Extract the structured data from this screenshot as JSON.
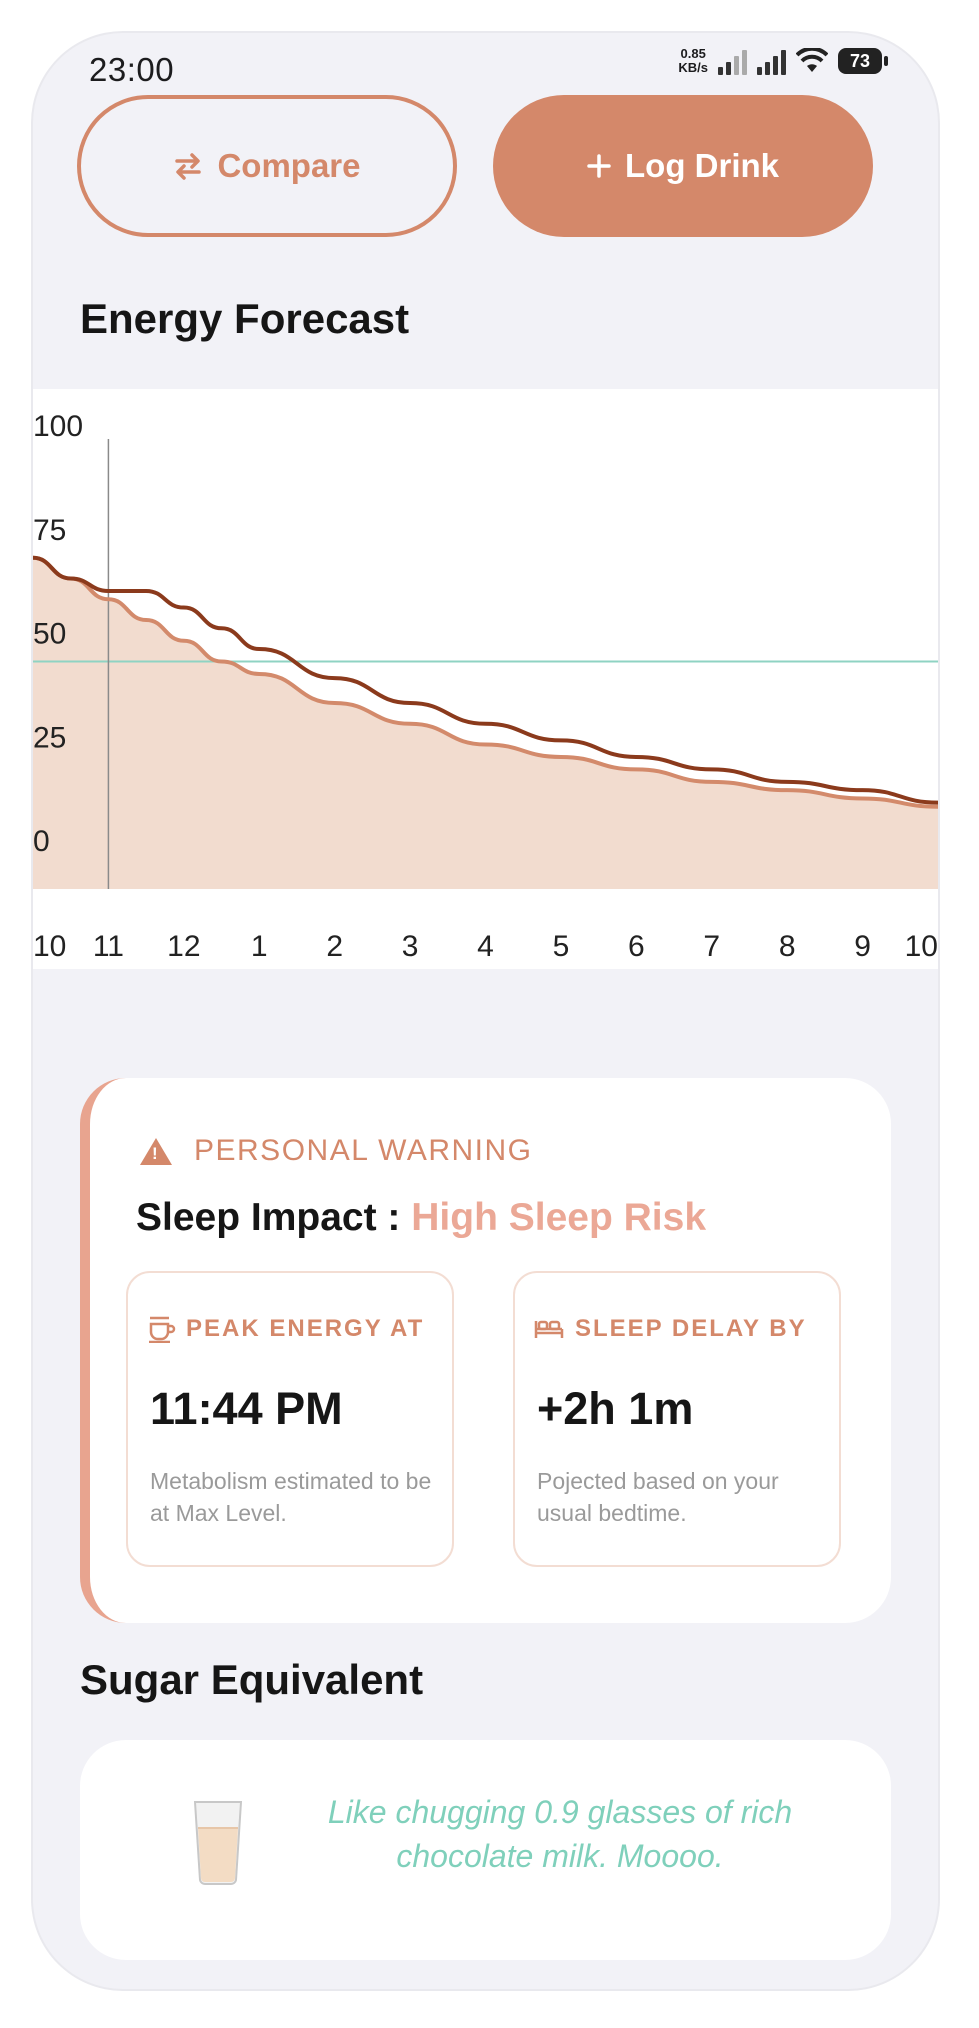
{
  "status_bar": {
    "time": "23:00",
    "net_speed_value": "0.85",
    "net_speed_unit": "KB/s",
    "battery": "73"
  },
  "buttons": {
    "compare": "Compare",
    "log_drink": "Log Drink"
  },
  "icons": {
    "compare": "swap-arrows-icon",
    "log_drink": "plus-icon"
  },
  "energy_section": {
    "title": "Energy Forecast"
  },
  "chart_data": {
    "type": "area",
    "ylim": [
      0,
      100
    ],
    "yticks": [
      "100",
      "75",
      "50",
      "25",
      "0"
    ],
    "xticks": [
      "10",
      "11",
      "12",
      "1",
      "2",
      "3",
      "4",
      "5",
      "6",
      "7",
      "8",
      "9",
      "10"
    ],
    "threshold": 50,
    "current_marker": "11",
    "x": [
      0,
      0.5,
      1,
      1.5,
      2,
      2.5,
      3,
      4,
      5,
      6,
      7,
      8,
      9,
      10,
      11,
      12
    ],
    "series": [
      {
        "values": [
          75,
          70,
          65,
          60,
          55,
          50,
          47,
          40,
          35,
          30,
          27,
          24,
          21,
          19,
          17,
          15
        ]
      },
      {
        "values": [
          75,
          70,
          67,
          67,
          63,
          58,
          53,
          46,
          40,
          35,
          31,
          27,
          24,
          21,
          19,
          16
        ]
      }
    ],
    "colors": {
      "area": "#f2dccf",
      "base_line": "#d38a6b",
      "projected_line": "#8b3a1c",
      "threshold": "#8fd3c3",
      "marker": "#8a8a8a"
    }
  },
  "warning_card": {
    "header": "PERSONAL WARNING",
    "impact_label": "Sleep Impact :",
    "impact_value": "High Sleep Risk",
    "peak": {
      "label": "PEAK ENERGY AT",
      "value": "11:44 PM",
      "note": "Metabolism estimated to be at Max Level."
    },
    "sleep": {
      "label": "SLEEP DELAY BY",
      "value": "+2h 1m",
      "note": "Pojected based on your usual bedtime."
    }
  },
  "sugar_section": {
    "title": "Sugar Equivalent",
    "message": "Like chugging 0.9 glasses of rich chocolate milk. Moooo."
  },
  "theme": {
    "accent": "#d4886a",
    "risk": "#eba896",
    "mint": "#7fd0bb"
  }
}
